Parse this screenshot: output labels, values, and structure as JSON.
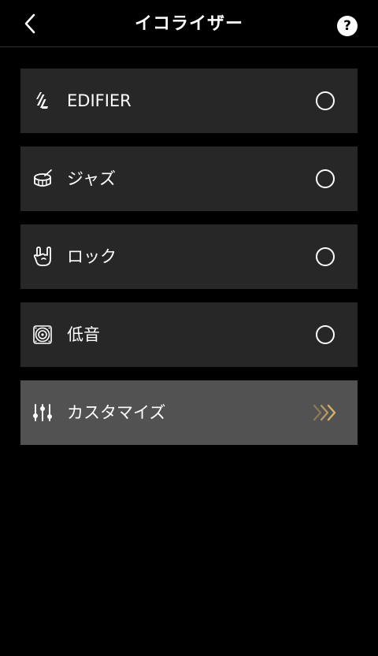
{
  "header": {
    "title": "イコライザー",
    "help_label": "?"
  },
  "presets": [
    {
      "label": "EDIFIER",
      "icon": "edifier-logo-icon",
      "selected": false
    },
    {
      "label": "ジャズ",
      "icon": "drum-icon",
      "selected": false
    },
    {
      "label": "ロック",
      "icon": "rock-hand-icon",
      "selected": false
    },
    {
      "label": "低音",
      "icon": "speaker-icon",
      "selected": false
    }
  ],
  "custom": {
    "label": "カスタマイズ",
    "icon": "sliders-icon",
    "action_icon": "triple-chevron-right-icon"
  },
  "colors": {
    "background": "#000000",
    "item_background": "#272727",
    "custom_background": "#525252",
    "accent_gold": "#d8b06a"
  }
}
